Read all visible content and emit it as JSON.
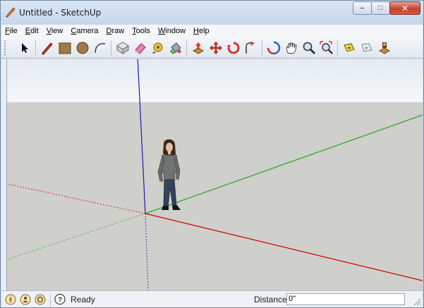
{
  "window": {
    "title": "Untitled - SketchUp",
    "minimize_label": "–",
    "maximize_label": "□",
    "close_label": "✕"
  },
  "menu": {
    "items": [
      {
        "label": "File",
        "accel": "F",
        "rest": "ile"
      },
      {
        "label": "Edit",
        "accel": "E",
        "rest": "dit"
      },
      {
        "label": "View",
        "accel": "V",
        "rest": "iew"
      },
      {
        "label": "Camera",
        "accel": "C",
        "rest": "amera"
      },
      {
        "label": "Draw",
        "accel": "D",
        "rest": "raw"
      },
      {
        "label": "Tools",
        "accel": "T",
        "rest": "ools"
      },
      {
        "label": "Window",
        "accel": "W",
        "rest": "indow"
      },
      {
        "label": "Help",
        "accel": "H",
        "rest": "elp"
      }
    ]
  },
  "toolbar": {
    "tools": [
      "select-icon",
      "pencil-icon",
      "rectangle-icon",
      "circle-icon",
      "arc-icon",
      "make-component-icon",
      "eraser-icon",
      "tape-measure-icon",
      "paint-bucket-icon",
      "push-pull-icon",
      "move-icon",
      "rotate-icon",
      "follow-me-icon",
      "orbit-icon",
      "pan-icon",
      "zoom-icon",
      "zoom-extents-icon",
      "previous-view-icon",
      "next-view-icon",
      "position-camera-icon"
    ]
  },
  "colors": {
    "axis_red": "#cc0000",
    "axis_green": "#22aa22",
    "axis_blue": "#1a1aaa",
    "ground": "#cfcfcb",
    "sky_top": "#e4eaf0"
  },
  "status": {
    "text": "Ready",
    "measurement_label": "Distance",
    "measurement_value": "0\""
  }
}
